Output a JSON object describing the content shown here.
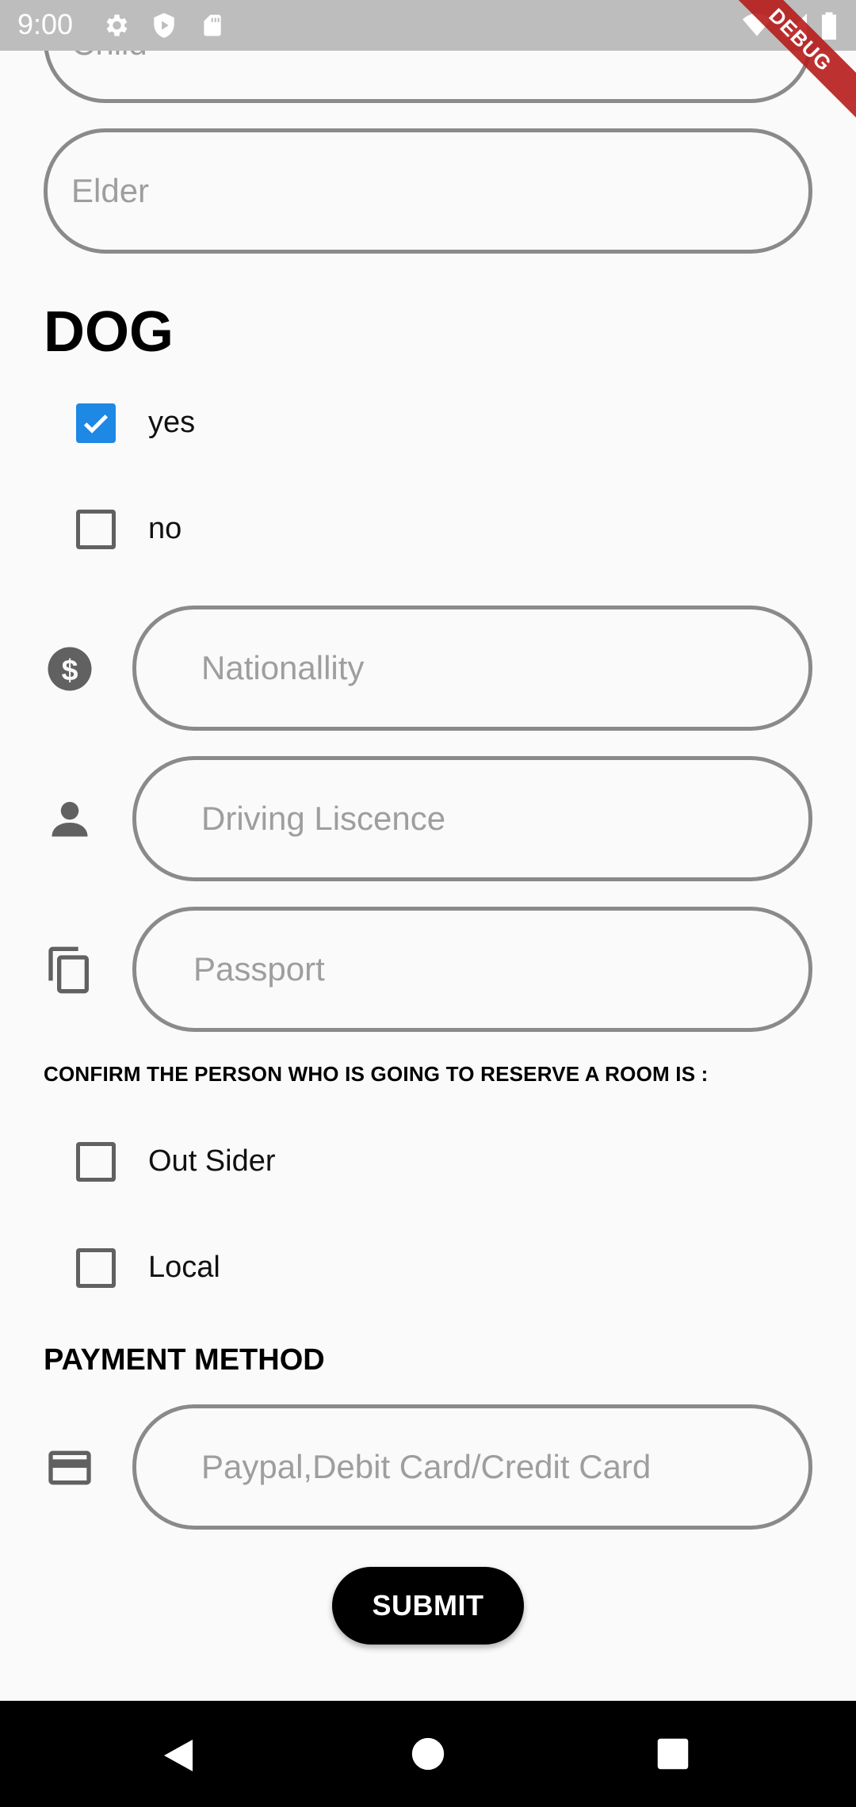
{
  "status_bar": {
    "time": "9:00",
    "icons": [
      "settings-icon",
      "shield-play-icon",
      "sd-card-icon",
      "wifi-icon",
      "signal-icon",
      "battery-icon"
    ]
  },
  "debug_banner": "DEBUG",
  "form": {
    "child_placeholder": "Child",
    "elder_placeholder": "Elder",
    "dog_heading": "DOG",
    "dog_options": [
      {
        "label": "yes",
        "checked": true
      },
      {
        "label": "no",
        "checked": false
      }
    ],
    "nationality_placeholder": "Nationallity",
    "driving_placeholder": "Driving Liscence",
    "passport_placeholder": "Passport",
    "confirm_text": "CONFIRM THE PERSON WHO IS GOING TO RESERVE A ROOM IS :",
    "person_options": [
      {
        "label": "Out Sider",
        "checked": false
      },
      {
        "label": "Local",
        "checked": false
      }
    ],
    "payment_heading": "PAYMENT METHOD",
    "payment_placeholder": "Paypal,Debit Card/Credit Card",
    "submit_label": "SUBMIT"
  },
  "colors": {
    "accent": "#1e88e5",
    "border": "#8a8a8a",
    "placeholder": "#9e9e9e",
    "background": "#fafafa"
  }
}
